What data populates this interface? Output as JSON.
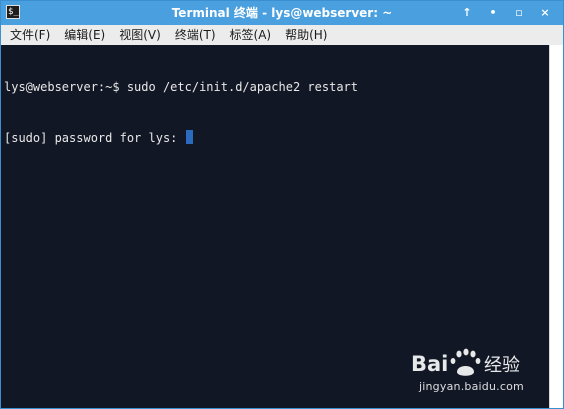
{
  "window": {
    "title": "Terminal 终端 - lys@webserver: ~",
    "app_icon_glyph": "$_",
    "controls": {
      "pin": "↑",
      "minimize": "•",
      "maximize": "▫",
      "close": "×"
    }
  },
  "menubar": {
    "items": [
      "文件(F)",
      "编辑(E)",
      "视图(V)",
      "终端(T)",
      "标签(A)",
      "帮助(H)"
    ]
  },
  "terminal": {
    "lines": [
      "lys@webserver:~$ sudo /etc/init.d/apache2 restart",
      "[sudo] password for lys: "
    ]
  },
  "watermark": {
    "logo_text": "Bai百度经验",
    "url": "jingyan.baidu.com"
  },
  "colors": {
    "titlebar": "#4a9fdf",
    "terminal_bg": "#121725",
    "terminal_fg": "#e8e8e8",
    "cursor": "#2a6bbf",
    "menubar_bg": "#ececec"
  }
}
